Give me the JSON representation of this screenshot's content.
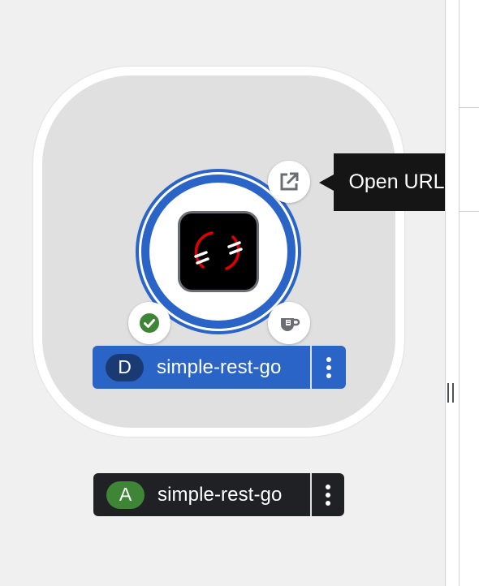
{
  "topology": {
    "application_group": {
      "workload": {
        "icon": "openshift-logo-icon",
        "ring_color": "#2b64c7",
        "decorators": {
          "status_icon": "check-circle-icon",
          "status_color": "#3e8635",
          "open_url_icon": "external-link-icon",
          "edit_icon": "coffee-cup-icon"
        },
        "label": {
          "badge": "D",
          "name": "simple-rest-go",
          "badge_color": "#1a3a73",
          "background": "#2b64c7"
        }
      },
      "group_label": {
        "badge": "A",
        "name": "simple-rest-go",
        "badge_color": "#3e8635",
        "background": "#1f2124"
      }
    },
    "tooltip": {
      "text": "Open URL"
    }
  },
  "side_panel": {
    "resize_handle_icon": "grip-vertical-icon"
  }
}
